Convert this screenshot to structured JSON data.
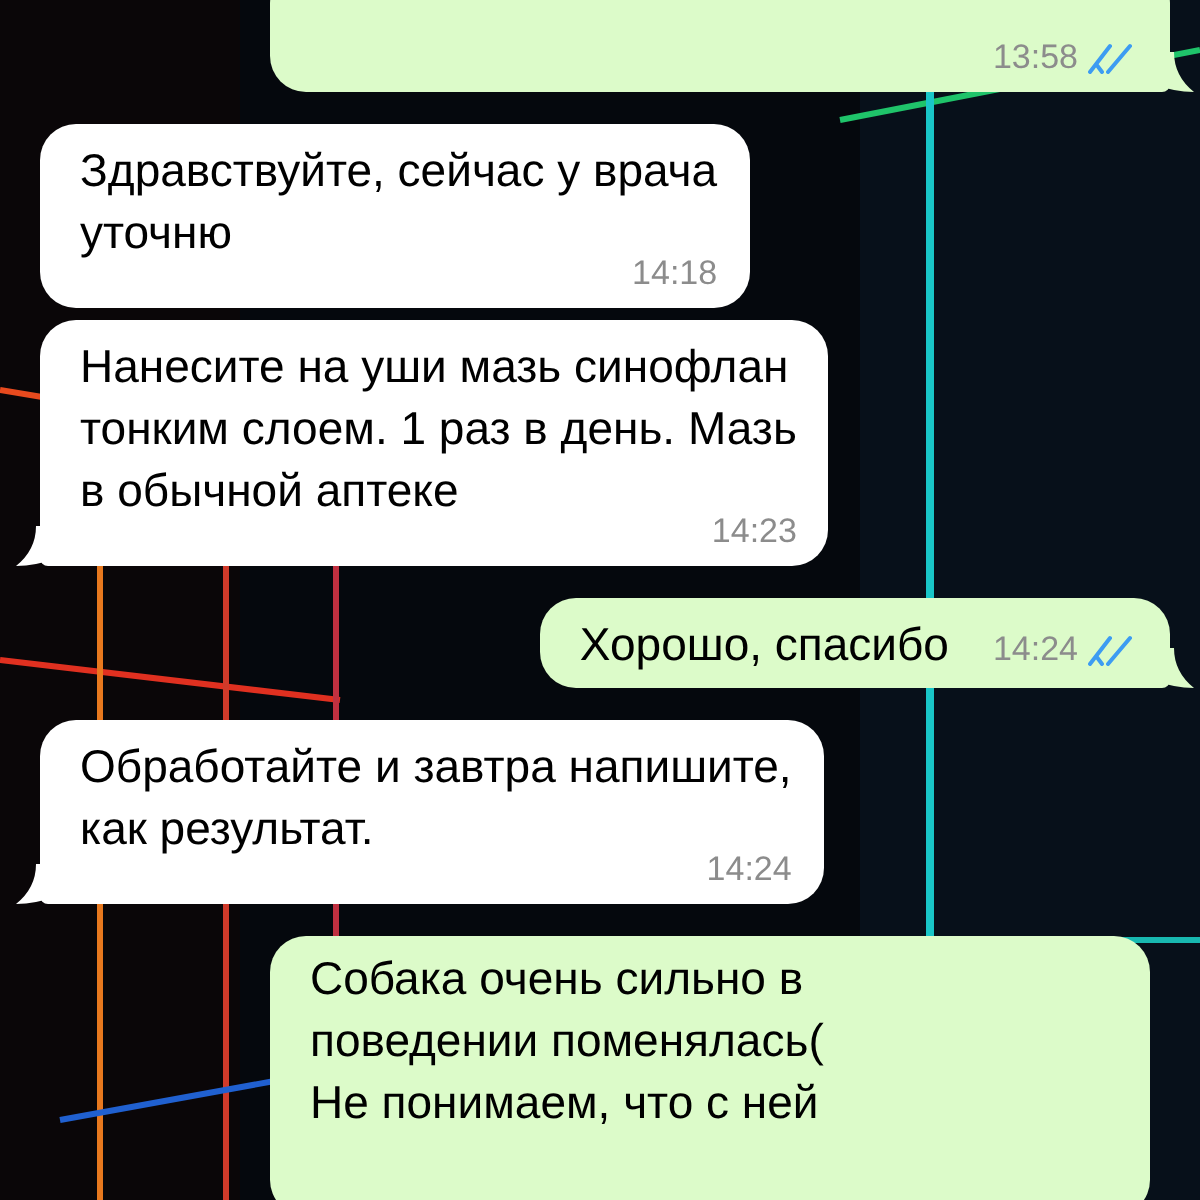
{
  "messages": [
    {
      "kind": "out",
      "time": "13:58",
      "read": true,
      "tail": true
    },
    {
      "kind": "in",
      "text": "Здравствуйте, сейчас у врача\nуточню",
      "time": "14:18",
      "tail": false
    },
    {
      "kind": "in",
      "text": "Нанесите на уши мазь синофлан\nтонким слоем. 1 раз в день. Мазь\nв обычной аптеке",
      "time": "14:23",
      "tail": true
    },
    {
      "kind": "out",
      "text": "Хорошо, спасибо",
      "time": "14:24",
      "read": true,
      "tail": true
    },
    {
      "kind": "in",
      "text": "Обработайте и завтра напишите,\nкак результат.",
      "time": "14:24",
      "tail": true
    },
    {
      "kind": "out",
      "text": "Собака очень сильно в\nповедении поменялась(\nНе понимаем, что с ней",
      "tail": false
    }
  ]
}
